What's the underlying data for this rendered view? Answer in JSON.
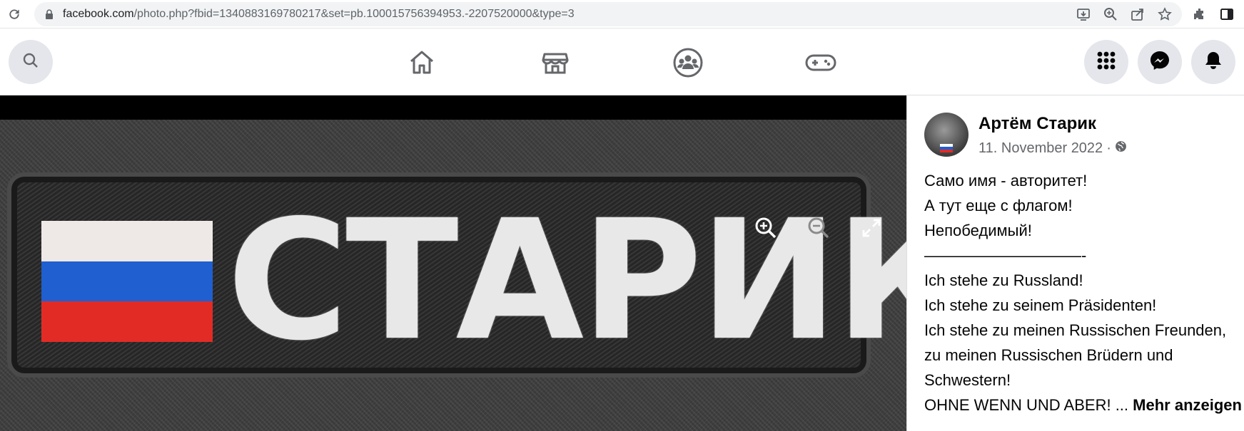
{
  "browser": {
    "url_domain": "facebook.com",
    "url_path": "/photo.php?fbid=1340883169780217&set=pb.100015756394953.-2207520000&type=3"
  },
  "photo": {
    "patch_text": "СТАРИК"
  },
  "post": {
    "author": "Артём Старик",
    "date": "11. November 2022",
    "separator": "·",
    "lines": [
      "Само имя - авторитет!",
      "А тут еще с флагом!",
      "Непобедимый!",
      "——————————-",
      "Ich stehe zu Russland!",
      "Ich stehe zu seinem Präsidenten!",
      "Ich stehe zu meinen Russischen Freunden,",
      "zu meinen Russischen Brüdern und",
      "Schwestern!"
    ],
    "last_line": "OHNE WENN UND ABER! ...",
    "more_label": "Mehr anzeigen"
  }
}
